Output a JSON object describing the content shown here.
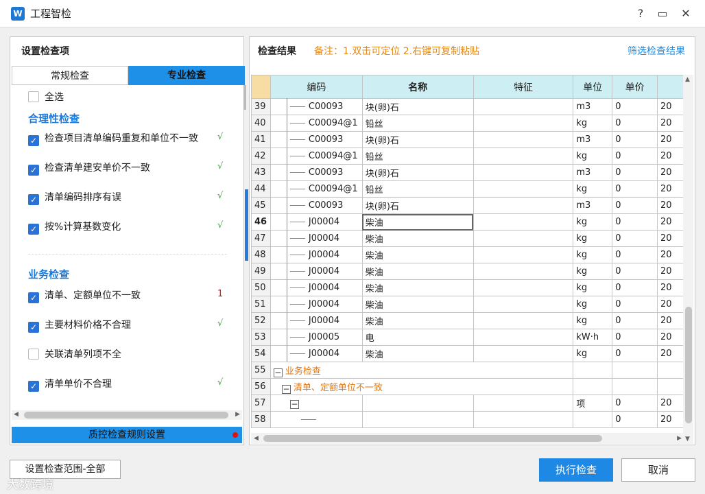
{
  "window": {
    "icon_letter": "W",
    "title": "工程智检",
    "help": "?",
    "maximize": "▭",
    "close": "✕"
  },
  "left": {
    "title": "设置检查项",
    "tabs": [
      "常规检查",
      "专业检查"
    ],
    "select_all": "全选",
    "section1": "合理性检查",
    "items1": [
      {
        "label": "检查项目清单编码重复和单位不一致",
        "mark": "√"
      },
      {
        "label": "检查清单建安单价不一致",
        "mark": "√"
      },
      {
        "label": "清单编码排序有误",
        "mark": "√"
      },
      {
        "label": "按%计算基数变化",
        "mark": "√"
      }
    ],
    "section2": "业务检查",
    "items2": [
      {
        "label": "清单、定额单位不一致",
        "mark": "1"
      },
      {
        "label": "主要材料价格不合理",
        "mark": "√"
      },
      {
        "label": "关联清单列项不全",
        "mark": ""
      },
      {
        "label": "清单单价不合理",
        "mark": "√"
      }
    ],
    "rule_button": "质控检查规则设置"
  },
  "right": {
    "title": "检查结果",
    "note": "备注：1.双击可定位 2.右键可复制粘贴",
    "filter": "筛选检查结果",
    "columns": [
      "编码",
      "名称",
      "特征",
      "单位",
      "单价"
    ],
    "rows": [
      {
        "n": "39",
        "code": "C00093",
        "name": "块(卵)石",
        "unit": "m3",
        "price": "0",
        "extra": "20"
      },
      {
        "n": "40",
        "code": "C00094@1",
        "name": "铅丝",
        "unit": "kg",
        "price": "0",
        "extra": "20"
      },
      {
        "n": "41",
        "code": "C00093",
        "name": "块(卵)石",
        "unit": "m3",
        "price": "0",
        "extra": "20"
      },
      {
        "n": "42",
        "code": "C00094@1",
        "name": "铅丝",
        "unit": "kg",
        "price": "0",
        "extra": "20"
      },
      {
        "n": "43",
        "code": "C00093",
        "name": "块(卵)石",
        "unit": "m3",
        "price": "0",
        "extra": "20"
      },
      {
        "n": "44",
        "code": "C00094@1",
        "name": "铅丝",
        "unit": "kg",
        "price": "0",
        "extra": "20"
      },
      {
        "n": "45",
        "code": "C00093",
        "name": "块(卵)石",
        "unit": "m3",
        "price": "0",
        "extra": "20"
      },
      {
        "n": "46",
        "code": "J00004",
        "name": "柴油",
        "unit": "kg",
        "price": "0",
        "extra": "20"
      },
      {
        "n": "47",
        "code": "J00004",
        "name": "柴油",
        "unit": "kg",
        "price": "0",
        "extra": "20"
      },
      {
        "n": "48",
        "code": "J00004",
        "name": "柴油",
        "unit": "kg",
        "price": "0",
        "extra": "20"
      },
      {
        "n": "49",
        "code": "J00004",
        "name": "柴油",
        "unit": "kg",
        "price": "0",
        "extra": "20"
      },
      {
        "n": "50",
        "code": "J00004",
        "name": "柴油",
        "unit": "kg",
        "price": "0",
        "extra": "20"
      },
      {
        "n": "51",
        "code": "J00004",
        "name": "柴油",
        "unit": "kg",
        "price": "0",
        "extra": "20"
      },
      {
        "n": "52",
        "code": "J00004",
        "name": "柴油",
        "unit": "kg",
        "price": "0",
        "extra": "20"
      },
      {
        "n": "53",
        "code": "J00005",
        "name": "电",
        "unit": "kW·h",
        "price": "0",
        "extra": "20"
      },
      {
        "n": "54",
        "code": "J00004",
        "name": "柴油",
        "unit": "kg",
        "price": "0",
        "extra": "20"
      }
    ],
    "group_rows": [
      {
        "n": "55",
        "label": "业务检查"
      },
      {
        "n": "56",
        "label": "清单、定额单位不一致"
      },
      {
        "n": "57",
        "unit": "项",
        "price": "0",
        "extra": "20"
      },
      {
        "n": "58",
        "price": "0",
        "extra": "20"
      }
    ]
  },
  "footer": {
    "scope": "设置检查范围-全部",
    "run": "执行检查",
    "cancel": "取消"
  },
  "watermark": "大数跨境",
  "colors": {
    "accent": "#1e90e8",
    "note": "#e08a1c",
    "ok": "#3a9a3a",
    "bad": "#d01818"
  }
}
